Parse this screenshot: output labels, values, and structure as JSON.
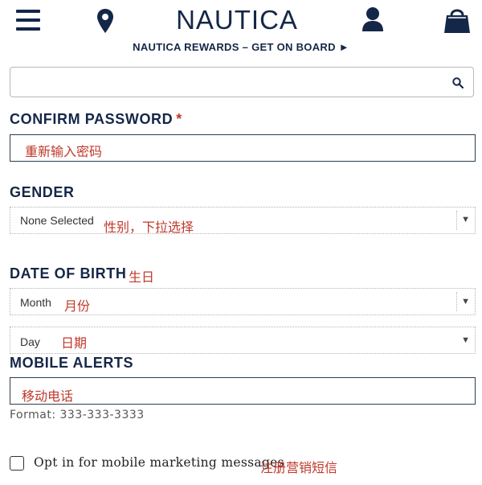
{
  "header": {
    "brand": "NAUTICA",
    "rewards": "NAUTICA REWARDS – GET ON BOARD ►",
    "icons": [
      "menu-icon",
      "location-pin-icon",
      "user-icon",
      "shopping-bag-icon"
    ]
  },
  "search": {
    "value": "",
    "placeholder": "",
    "icon": "search-icon"
  },
  "confirm_password": {
    "label": "CONFIRM PASSWORD",
    "required_mark": "*",
    "annotation": "重新输入密码"
  },
  "gender": {
    "label": "GENDER",
    "selected": "None Selected",
    "annotation": "性别，下拉选择"
  },
  "dob": {
    "label": "DATE OF BIRTH",
    "annotation": "生日",
    "month": {
      "selected": "Month",
      "annotation": "月份"
    },
    "day": {
      "selected": "Day",
      "annotation": "日期"
    }
  },
  "mobile": {
    "label": "MOBILE ALERTS",
    "annotation": "移动电话",
    "format": "Format: 333-333-3333"
  },
  "optin": {
    "label": "Opt in for mobile marketing messages",
    "annotation": "注册营销短信",
    "checked": false
  },
  "colors": {
    "brand": "#152748",
    "annotation": "#c0392b",
    "required": "#c0392b"
  }
}
